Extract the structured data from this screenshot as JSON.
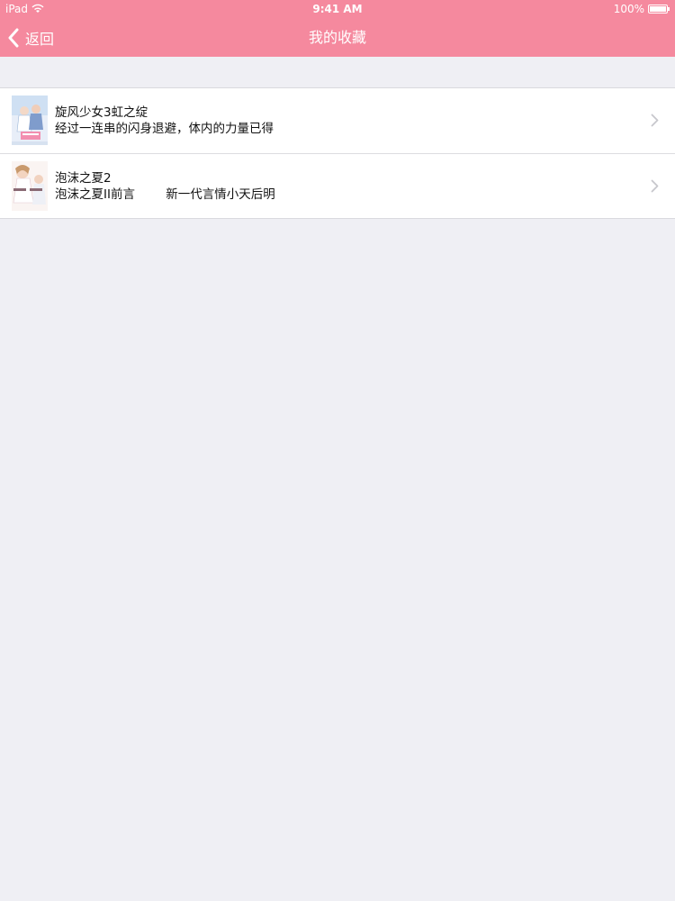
{
  "status_bar": {
    "device": "iPad",
    "time": "9:41 AM",
    "battery": "100%"
  },
  "nav": {
    "back_label": "返回",
    "title": "我的收藏"
  },
  "favorites": [
    {
      "title": "旋风少女3虹之绽",
      "summary": "经过一连串的闪身退避，体内的力量已得"
    },
    {
      "title": "泡沫之夏2",
      "summary": "泡沫之夏II前言        新一代言情小天后明"
    }
  ],
  "colors": {
    "accent": "#f5899e",
    "background": "#efeff4"
  }
}
